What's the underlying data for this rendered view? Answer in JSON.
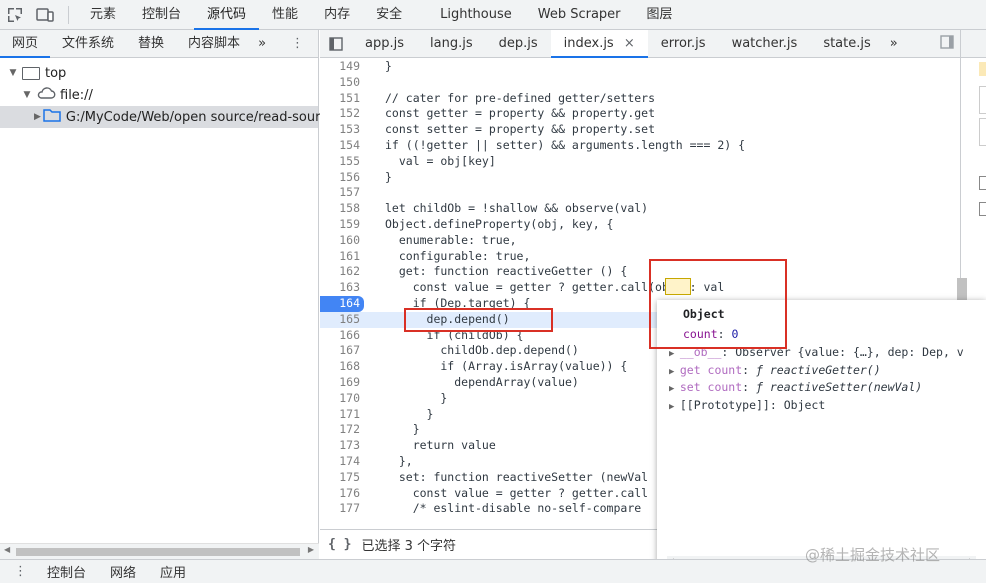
{
  "toolbar": {
    "tabs": [
      "元素",
      "控制台",
      "源代码",
      "性能",
      "内存",
      "安全",
      "Lighthouse",
      "Web Scraper",
      "图层"
    ],
    "active_tab": "源代码"
  },
  "navigator": {
    "tabs": [
      "网页",
      "文件系统",
      "替换",
      "内容脚本"
    ],
    "more": "»",
    "tree": {
      "top": "top",
      "origin": "file://",
      "folder": "G:/MyCode/Web/open source/read-source"
    }
  },
  "editor": {
    "tabs": [
      "app.js",
      "lang.js",
      "dep.js",
      "index.js",
      "error.js",
      "watcher.js",
      "state.js"
    ],
    "active_tab": "index.js",
    "close_glyph": "×",
    "more": "»",
    "lines": [
      {
        "n": "149",
        "text": "}"
      },
      {
        "n": "150",
        "text": ""
      },
      {
        "n": "151",
        "text": "// cater for pre-defined getter/setters"
      },
      {
        "n": "152",
        "text": "const getter = property && property.get"
      },
      {
        "n": "153",
        "text": "const setter = property && property.set"
      },
      {
        "n": "154",
        "text": "if ((!getter || setter) && arguments.length === 2) {"
      },
      {
        "n": "155",
        "text": "  val = obj[key]"
      },
      {
        "n": "156",
        "text": "}"
      },
      {
        "n": "157",
        "text": ""
      },
      {
        "n": "158",
        "text": "let childOb = !shallow && observe(val)"
      },
      {
        "n": "159",
        "text": "Object.defineProperty(obj, key, {"
      },
      {
        "n": "160",
        "text": "  enumerable: true,"
      },
      {
        "n": "161",
        "text": "  configurable: true,"
      },
      {
        "n": "162",
        "text": "  get: function reactiveGetter () {"
      },
      {
        "n": "163",
        "text": "    const value = getter ? getter.call(obj) : val"
      },
      {
        "n": "164",
        "text": "    if (Dep.target) {"
      },
      {
        "n": "165",
        "text": "      dep.depend()"
      },
      {
        "n": "166",
        "text": "      if (childOb) {"
      },
      {
        "n": "167",
        "text": "        childOb.dep.depend()"
      },
      {
        "n": "168",
        "text": "        if (Array.isArray(value)) {"
      },
      {
        "n": "169",
        "text": "          dependArray(value)"
      },
      {
        "n": "170",
        "text": "        }"
      },
      {
        "n": "171",
        "text": "      }"
      },
      {
        "n": "172",
        "text": "    }"
      },
      {
        "n": "173",
        "text": "    return value"
      },
      {
        "n": "174",
        "text": "  },"
      },
      {
        "n": "175",
        "text": "  set: function reactiveSetter (newVal"
      },
      {
        "n": "176",
        "text": "    const value = getter ? getter.call"
      },
      {
        "n": "177",
        "text": "    /* eslint-disable no-self-compare"
      }
    ],
    "status": "已选择 3 个字符",
    "status_icon": "{ }"
  },
  "popover": {
    "title": "Object",
    "rows": [
      {
        "key": "count",
        "sep": ": ",
        "value": "0"
      },
      {
        "key": "__ob__",
        "sep": ": ",
        "value": "Observer {value: {…}, dep: Dep, v"
      },
      {
        "key": "get count",
        "sep": ": ",
        "value": "ƒ reactiveGetter()"
      },
      {
        "key": "set count",
        "sep": ": ",
        "value": "ƒ reactiveSetter(newVal)"
      },
      {
        "key": "[[Prototype]]",
        "sep": ": ",
        "value": "Object"
      }
    ]
  },
  "drawer": {
    "tabs": [
      "控制台",
      "网络",
      "应用"
    ]
  },
  "watermark": "@稀土掘金技术社区",
  "colors": {
    "accent": "#1a73e8",
    "annotation": "#d93025",
    "exec_line": "#e0ecfd"
  }
}
